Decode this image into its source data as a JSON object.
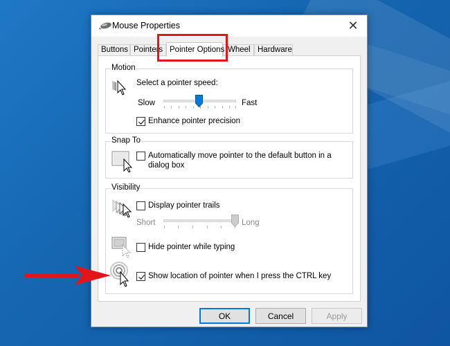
{
  "window": {
    "title": "Mouse Properties",
    "close_glyph": "✕"
  },
  "tabs": [
    {
      "label": "Buttons"
    },
    {
      "label": "Pointers"
    },
    {
      "label": "Pointer Options",
      "active": true
    },
    {
      "label": "Wheel"
    },
    {
      "label": "Hardware"
    }
  ],
  "motion": {
    "group_label": "Motion",
    "prompt": "Select a pointer speed:",
    "slow_label": "Slow",
    "fast_label": "Fast",
    "speed_level": 0.55,
    "precision_label": "Enhance pointer precision",
    "precision_checked": true
  },
  "snap_to": {
    "group_label": "Snap To",
    "line1": "Automatically move pointer to the default button in a",
    "line2": "dialog box",
    "checked": false
  },
  "visibility": {
    "group_label": "Visibility",
    "trails_label": "Display pointer trails",
    "trails_checked": false,
    "short_label": "Short",
    "long_label": "Long",
    "trail_level": 1.0,
    "hide_label": "Hide pointer while typing",
    "hide_checked": false,
    "ctrl_label": "Show location of pointer when I press the CTRL key",
    "ctrl_checked": true
  },
  "buttons": {
    "ok": "OK",
    "cancel": "Cancel",
    "apply": "Apply"
  },
  "annotation_colors": {
    "highlight": "#e0161b",
    "accent": "#0078d7"
  },
  "icons": [
    "mouse-icon",
    "close-icon",
    "pointer-speed-icon",
    "snap-to-icon",
    "pointer-trails-icon",
    "hide-pointer-icon",
    "pointer-location-icon",
    "annotation-arrow"
  ]
}
